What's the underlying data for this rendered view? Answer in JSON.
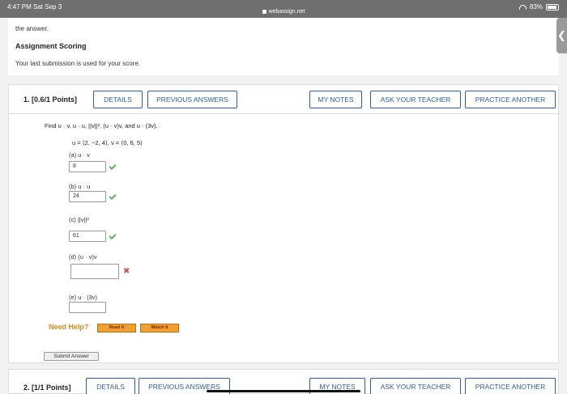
{
  "status": {
    "time": "4:47 PM  Sat Sep 3",
    "url": "webassign.net",
    "battery": "83%"
  },
  "intro": {
    "text": "the answer.",
    "heading": "Assignment Scoring",
    "note": "Your last submission is used for your score."
  },
  "side_tab": {
    "glyph": "❮"
  },
  "question1": {
    "number": "1.  [0.6/1 Points]",
    "buttons": {
      "details": "DETAILS",
      "previous_answers": "PREVIOUS ANSWERS",
      "my_notes": "MY NOTES",
      "ask_teacher": "ASK YOUR TEACHER",
      "practice_another": "PRACTICE ANOTHER"
    },
    "prompt": "Find u · v, u · u, ||v||², (u · v)v, and u · (3v).",
    "vectors": "u = ⟨2, −2, 4⟩,   v = ⟨0, 6, 5⟩",
    "parts": [
      {
        "label": "(a)     u · v",
        "value": "8",
        "status": "correct"
      },
      {
        "label": "(b)     u · u",
        "value": "24",
        "status": "correct"
      },
      {
        "label": "(c)     ||v||²",
        "value": "61",
        "status": "correct"
      },
      {
        "label": "(d)     (u · v)v",
        "value": "",
        "status": "incorrect"
      },
      {
        "label": "(e)     u · (3v)",
        "value": "",
        "status": "unanswered"
      }
    ],
    "need_help": "Need Help?",
    "read_it": "Read It",
    "watch_it": "Watch It",
    "submit": "Submit Answer"
  },
  "question2": {
    "number": "2.  [1/1 Points]",
    "buttons": {
      "details": "DETAILS",
      "previous_answers": "PREVIOUS ANSWERS",
      "my_notes": "MY NOTES",
      "ask_teacher": "ASK YOUR TEACHER",
      "practice_another": "PRACTICE ANOTHER"
    }
  }
}
